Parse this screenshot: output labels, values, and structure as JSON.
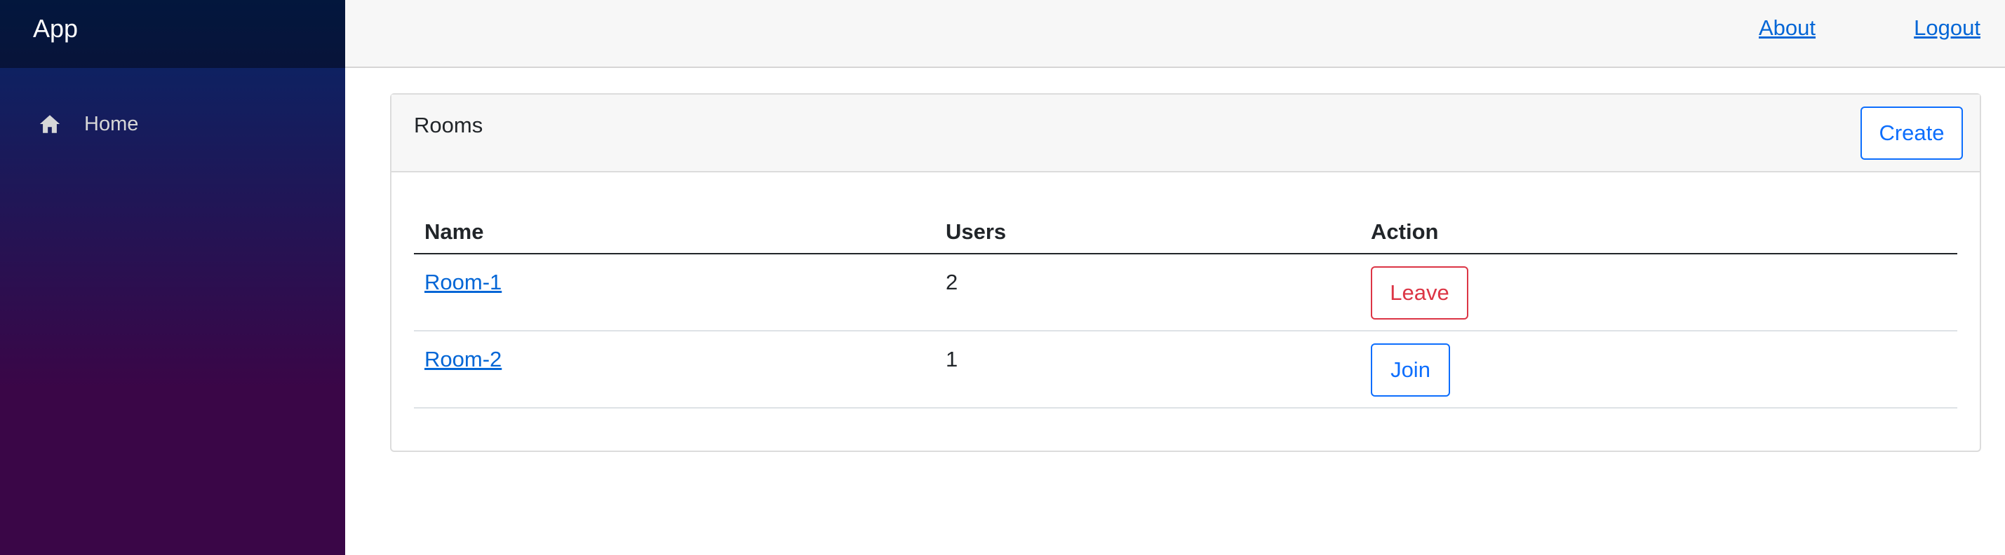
{
  "app": {
    "brand": "App"
  },
  "sidebar": {
    "items": [
      {
        "label": "Home",
        "icon": "home-icon"
      }
    ]
  },
  "topbar": {
    "links": [
      {
        "label": "About"
      },
      {
        "label": "Logout"
      }
    ]
  },
  "rooms": {
    "title": "Rooms",
    "create_label": "Create",
    "columns": [
      "Name",
      "Users",
      "Action"
    ],
    "rows": [
      {
        "name": "Room-1",
        "users": "2",
        "action": "Leave"
      },
      {
        "name": "Room-2",
        "users": "1",
        "action": "Join"
      }
    ]
  },
  "colors": {
    "link": "#0366d6",
    "primary": "#0d6efd",
    "danger": "#dc3545"
  }
}
